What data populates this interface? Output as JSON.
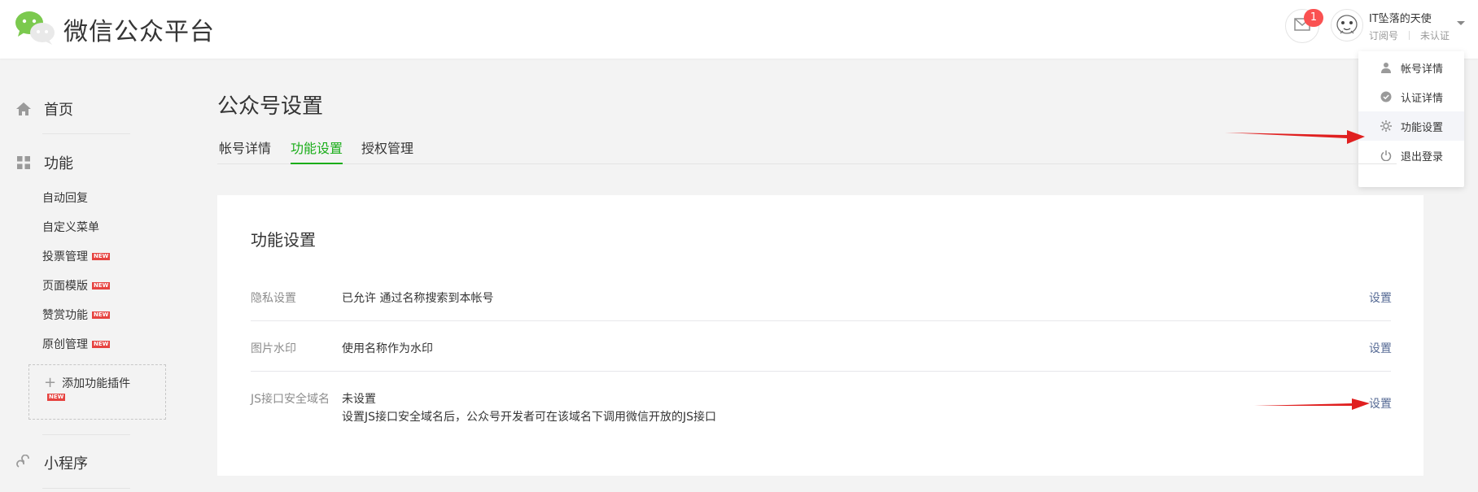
{
  "header": {
    "brand": "微信公众平台",
    "unread_count": "1",
    "user_name": "IT坠落的天使",
    "account_type": "订阅号",
    "verify_status": "未认证"
  },
  "account_menu": {
    "items": [
      {
        "label": "帐号详情",
        "icon": "user-icon"
      },
      {
        "label": "认证详情",
        "icon": "check-circle-icon"
      },
      {
        "label": "功能设置",
        "icon": "gear-icon"
      },
      {
        "label": "退出登录",
        "icon": "power-icon"
      }
    ]
  },
  "sidebar": {
    "home": "首页",
    "features": "功能",
    "sub_items": [
      {
        "label": "自动回复",
        "new": false
      },
      {
        "label": "自定义菜单",
        "new": false
      },
      {
        "label": "投票管理",
        "new": true
      },
      {
        "label": "页面模版",
        "new": true
      },
      {
        "label": "赞赏功能",
        "new": true
      },
      {
        "label": "原创管理",
        "new": true
      }
    ],
    "new_tag": "NEW",
    "add_plugin": "添加功能插件",
    "mini_program": "小程序"
  },
  "main": {
    "title": "公众号设置",
    "tabs": [
      "帐号详情",
      "功能设置",
      "授权管理"
    ],
    "active_tab": "功能设置",
    "card_title": "功能设置",
    "rows": [
      {
        "label": "隐私设置",
        "value": "已允许 通过名称搜索到本帐号",
        "action": "设置"
      },
      {
        "label": "图片水印",
        "value": "使用名称作为水印",
        "action": "设置"
      },
      {
        "label": "JS接口安全域名",
        "value": "未设置",
        "description": "设置JS接口安全域名后，公众号开发者可在该域名下调用微信开放的JS接口",
        "action": "设置"
      }
    ]
  },
  "colors": {
    "brand_green": "#1aad19",
    "link_blue": "#576b95",
    "badge_red": "#fa5151",
    "arrow_red": "#e02020"
  }
}
